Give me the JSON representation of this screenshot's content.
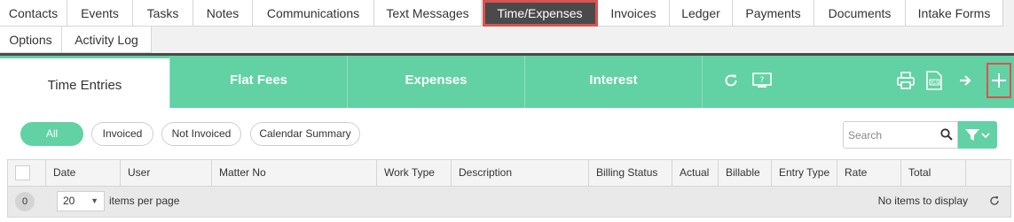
{
  "tabs": {
    "row1": [
      "Contacts",
      "Events",
      "Tasks",
      "Notes",
      "Communications",
      "Text Messages",
      "Time/Expenses",
      "Invoices",
      "Ledger",
      "Payments",
      "Documents",
      "Intake Forms"
    ],
    "row2": [
      "Options",
      "Activity Log"
    ],
    "active": "Time/Expenses"
  },
  "subtabs": [
    "Time Entries",
    "Flat Fees",
    "Expenses",
    "Interest"
  ],
  "toolbar_icons": [
    "refresh-icon",
    "help-screen-icon",
    "print-icon",
    "export-xls-icon",
    "arrow-right-icon",
    "plus-icon"
  ],
  "xls_label": "XLS",
  "filters": [
    "All",
    "Invoiced",
    "Not Invoiced",
    "Calendar Summary"
  ],
  "search": {
    "placeholder": "Search"
  },
  "grid": {
    "columns": [
      "Date",
      "User",
      "Matter No",
      "Work Type",
      "Description",
      "Billing Status",
      "Actual",
      "Billable",
      "Entry Type",
      "Rate",
      "Total"
    ]
  },
  "pager": {
    "page": "0",
    "page_size": "20",
    "per_page_label": "items per page",
    "empty_text": "No items to display"
  },
  "colors": {
    "accent": "#62d1a4",
    "active_tab": "#4a4a4a",
    "highlight": "#d9534f"
  }
}
